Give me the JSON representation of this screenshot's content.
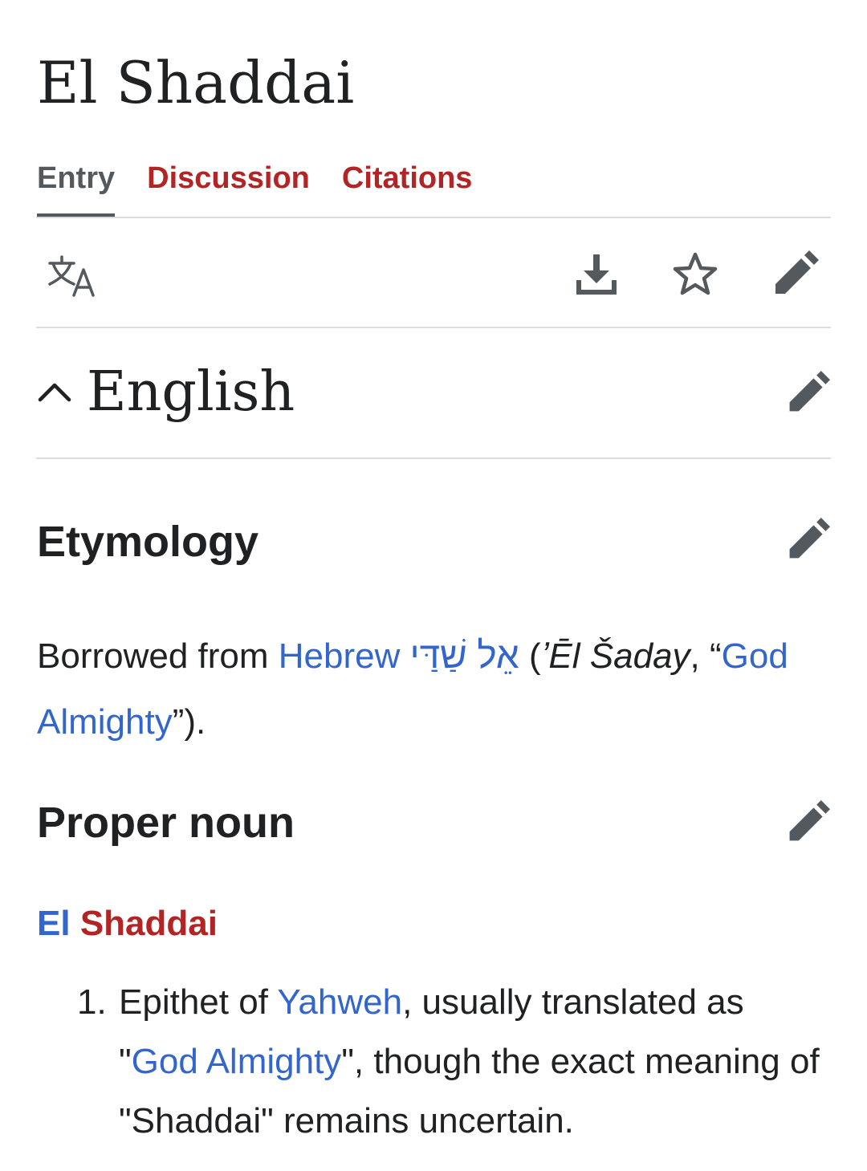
{
  "page": {
    "title": "El Shaddai"
  },
  "tabs": [
    {
      "label": "Entry",
      "active": true
    },
    {
      "label": "Discussion",
      "active": false
    },
    {
      "label": "Citations",
      "active": false
    }
  ],
  "toolbar": {
    "icons": [
      "language-icon",
      "download-icon",
      "star-icon",
      "edit-icon"
    ]
  },
  "section": {
    "heading": "English",
    "collapse_icon": "chevron-up-icon"
  },
  "etymology": {
    "heading": "Etymology",
    "prefix": "Borrowed from ",
    "language_link": "Hebrew",
    "space1": " ",
    "hebrew_word": "אֵל שַׁדַּי",
    "open": " (",
    "transliteration": "ʼĒl Šaday",
    "gloss_open": ", “",
    "gloss_link_part1": "God",
    "gloss_link_part2": "Almighty",
    "close": "”)."
  },
  "proper_noun": {
    "heading": "Proper noun",
    "headword_first": "El",
    "headword_space": " ",
    "headword_second": "Shaddai",
    "senses": [
      {
        "number": "1.",
        "t1": "Epithet of ",
        "link1": "Yahweh",
        "t2": ", usually translated as \"",
        "link2": "God Almighty",
        "t3": "\", though the exact meaning of \"Shaddai\" remains uncertain."
      }
    ]
  },
  "colors": {
    "link_blue": "#3366cc",
    "redlink": "#b32424",
    "icon_gray": "#54595d",
    "text": "#202122"
  }
}
